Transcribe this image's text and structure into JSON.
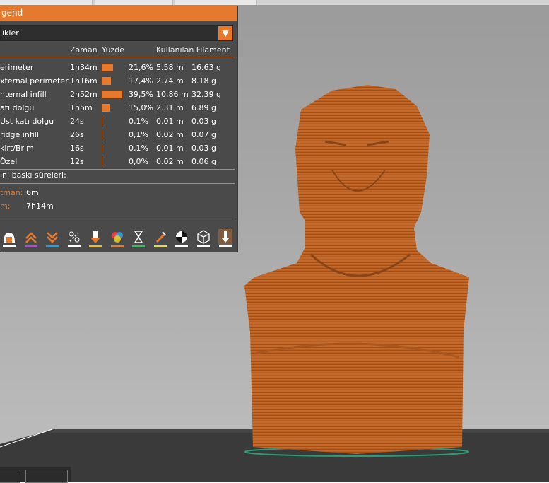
{
  "legend": {
    "title": "gend",
    "view_select": {
      "value": "ikler"
    },
    "columns": {
      "time": "Zaman",
      "percent": "Yüzde",
      "used_filament": "Kullanılan Filament"
    },
    "rows": [
      {
        "name": "erimeter",
        "time": "1h34m",
        "percent": "21,6%",
        "length": "5.58 m",
        "weight": "16.63 g",
        "fraction": 0.216
      },
      {
        "name": "xternal perimeter",
        "time": "1h16m",
        "percent": "17,4%",
        "length": "2.74 m",
        "weight": "8.18 g",
        "fraction": 0.174
      },
      {
        "name": "nternal infill",
        "time": "2h52m",
        "percent": "39,5%",
        "length": "10.86 m",
        "weight": "32.39 g",
        "fraction": 0.395
      },
      {
        "name": "atı dolgu",
        "time": "1h5m",
        "percent": "15,0%",
        "length": "2.31 m",
        "weight": "6.89 g",
        "fraction": 0.15
      },
      {
        "name": "Üst katı dolgu",
        "time": "24s",
        "percent": "0,1%",
        "length": "0.01 m",
        "weight": "0.03 g",
        "fraction": 0.001
      },
      {
        "name": "ridge infill",
        "time": "26s",
        "percent": "0,1%",
        "length": "0.02 m",
        "weight": "0.07 g",
        "fraction": 0.001
      },
      {
        "name": "kirt/Brim",
        "time": "16s",
        "percent": "0,1%",
        "length": "0.01 m",
        "weight": "0.03 g",
        "fraction": 0.001
      },
      {
        "name": "Özel",
        "time": "12s",
        "percent": "0,0%",
        "length": "0.02 m",
        "weight": "0.06 g",
        "fraction": 0.0
      }
    ],
    "print_times_heading": "ini baskı süreleri:",
    "print_times": [
      {
        "label": "tman:",
        "value": "6m"
      },
      {
        "label": "m:",
        "value": "7h14m"
      }
    ],
    "toolbar": [
      {
        "icon": "travel-icon"
      },
      {
        "icon": "retractions-icon"
      },
      {
        "icon": "deretractions-icon"
      },
      {
        "icon": "wipe-icon"
      },
      {
        "icon": "tool-change-icon"
      },
      {
        "icon": "color-change-icon"
      },
      {
        "icon": "pause-icon"
      },
      {
        "icon": "custom-gcode-icon"
      },
      {
        "icon": "center-of-gravity-icon"
      },
      {
        "icon": "shells-icon"
      },
      {
        "icon": "tool-marker-icon"
      }
    ]
  },
  "colors": {
    "accent": "#e57a2f",
    "panel": "#4a4a4a",
    "model": "#c86a2c"
  }
}
